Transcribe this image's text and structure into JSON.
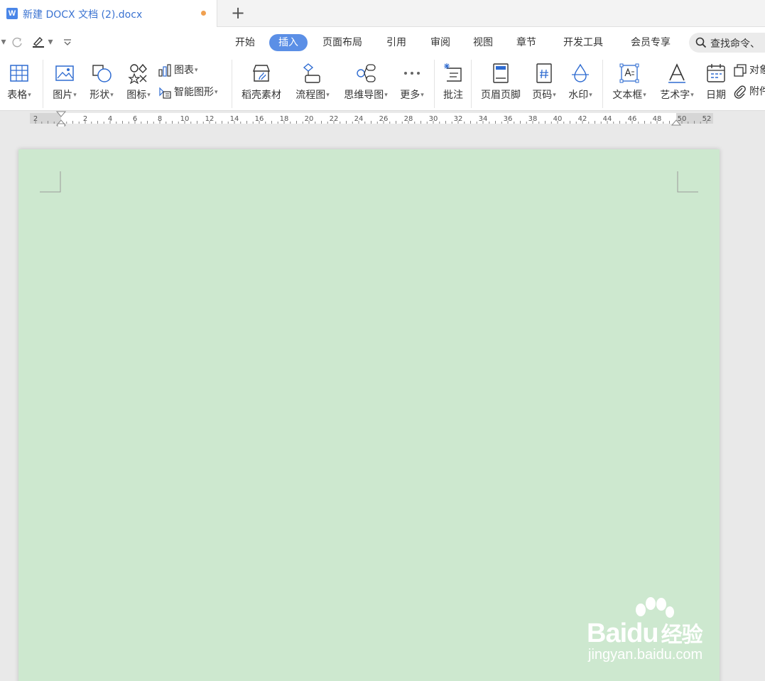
{
  "tab": {
    "title": "新建 DOCX 文档 (2).docx",
    "logo_letter": "W",
    "new_tab_symbol": "+"
  },
  "menu": {
    "items": [
      {
        "label": "开始"
      },
      {
        "label": "插入",
        "active": true
      },
      {
        "label": "页面布局"
      },
      {
        "label": "引用"
      },
      {
        "label": "审阅"
      },
      {
        "label": "视图"
      },
      {
        "label": "章节"
      },
      {
        "label": "开发工具"
      },
      {
        "label": "会员专享"
      }
    ],
    "search_placeholder": "查找命令、"
  },
  "ribbon": {
    "table": "表格",
    "picture": "图片",
    "shape": "形状",
    "icon": "图标",
    "chart": "图表",
    "smart_art": "智能图形",
    "daoke": "稻壳素材",
    "flowchart": "流程图",
    "mindmap": "思维导图",
    "more": "更多",
    "comment": "批注",
    "header_footer": "页眉页脚",
    "page_number": "页码",
    "watermark": "水印",
    "textbox": "文本框",
    "wordart": "艺术字",
    "date": "日期",
    "object": "对象",
    "attachment": "附件"
  },
  "ruler": {
    "labels": [
      "2",
      "2",
      "4",
      "6",
      "8",
      "10",
      "12",
      "14",
      "16",
      "18",
      "20",
      "22",
      "24",
      "26",
      "28",
      "30",
      "32",
      "34",
      "36",
      "38",
      "40",
      "42",
      "44",
      "46",
      "48",
      "50",
      "52"
    ]
  },
  "watermark": {
    "logo": "Bai",
    "logo_du": "du",
    "logo_cn": "经验",
    "url": "jingyan.baidu.com"
  },
  "colors": {
    "accent": "#5b8fe6",
    "page_bg": "#cde8cf",
    "tab_title": "#3b73d1",
    "unsaved_dot": "#f0a050"
  }
}
